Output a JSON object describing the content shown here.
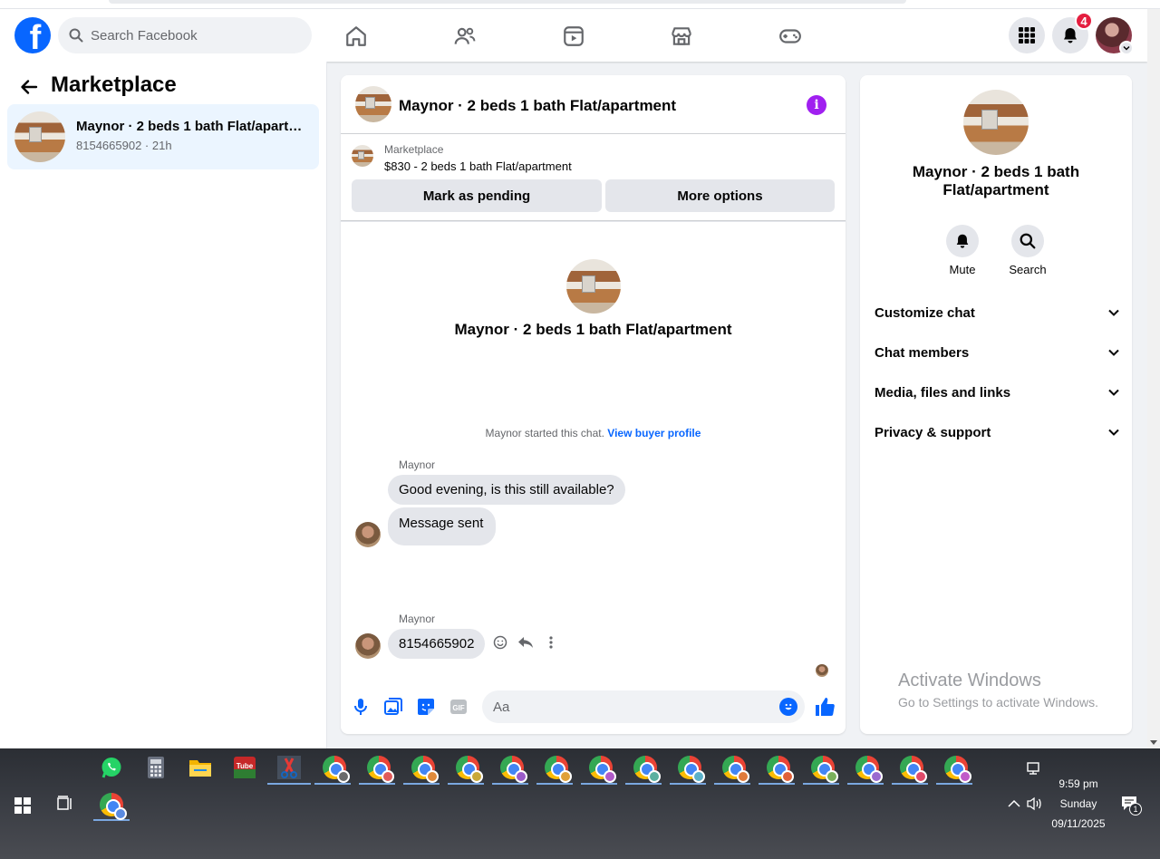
{
  "nav": {
    "search_placeholder": "Search Facebook",
    "notification_count": "4"
  },
  "sidebar": {
    "title": "Marketplace",
    "conversation": {
      "name": "Maynor · 2 beds 1 bath Flat/apartment",
      "subtitle": "8154665902 · 21h"
    }
  },
  "chat": {
    "header_title": "Maynor · 2 beds 1 bath Flat/apartment",
    "listing": {
      "category": "Marketplace",
      "price_line": "$830 - 2 beds 1 bath Flat/apartment"
    },
    "buttons": {
      "mark_pending": "Mark as pending",
      "more_options": "More options"
    },
    "intro_name": "Maynor · 2 beds 1 bath Flat/apartment",
    "started_text": "Maynor started this chat.",
    "view_profile": "View buyer profile",
    "messages": [
      {
        "sender": "Maynor",
        "text": "Good evening, is this still available?"
      },
      {
        "sender": "",
        "text": "Message sent"
      },
      {
        "sender": "Maynor",
        "text": "8154665902"
      }
    ],
    "composer_placeholder": "Aa"
  },
  "details": {
    "name": "Maynor · 2 beds 1 bath Flat/apartment",
    "actions": [
      "Mute",
      "Search"
    ],
    "sections": [
      "Customize chat",
      "Chat members",
      "Media, files and links",
      "Privacy & support"
    ],
    "watermark_title": "Activate Windows",
    "watermark_sub": "Go to Settings to activate Windows."
  },
  "taskbar": {
    "time": "9:59 pm",
    "day": "Sunday",
    "date": "09/11/2025",
    "notification_count": "1",
    "colors": {
      "chrome_profile_badges": [
        "#6b6b6b",
        "#e05a5a",
        "#e08a3a",
        "#c9a83a",
        "#9a5ac9",
        "#e0a03a",
        "#b05ac9",
        "#5ab0a0",
        "#5ab0c9",
        "#e07a3a",
        "#e0603a",
        "#7ab05a",
        "#9a6ad0",
        "#e04a6a",
        "#c05ac9"
      ]
    }
  },
  "colors": {
    "brand": "#0866ff",
    "info": "#a020f0",
    "badge": "#e41e3f"
  }
}
